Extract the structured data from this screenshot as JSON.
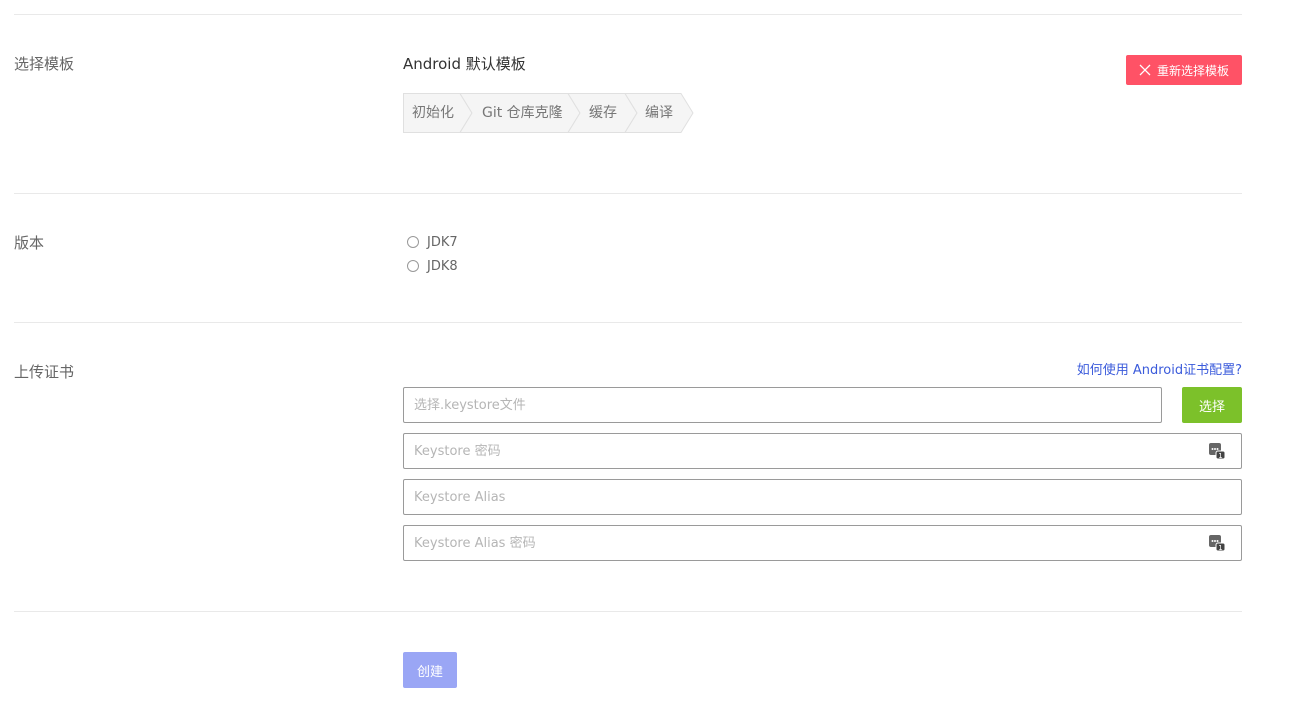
{
  "template_section": {
    "label": "选择模板",
    "template_name": "Android 默认模板",
    "reselect_label": "重新选择模板",
    "steps": [
      "初始化",
      "Git 仓库克隆",
      "缓存",
      "编译"
    ]
  },
  "version_section": {
    "label": "版本",
    "options": [
      "JDK7",
      "JDK8"
    ]
  },
  "cert_section": {
    "label": "上传证书",
    "help_link": "如何使用 Android证书配置?",
    "keystore_file_placeholder": "选择.keystore文件",
    "choose_label": "选择",
    "keystore_password_placeholder": "Keystore 密码",
    "keystore_alias_placeholder": "Keystore Alias",
    "keystore_alias_password_placeholder": "Keystore Alias 密码"
  },
  "actions": {
    "create_label": "创建"
  },
  "colors": {
    "danger": "#ff5266",
    "success": "#7cc12a",
    "primary_disabled": "#9aa6f5",
    "link": "#3b5bdb"
  }
}
